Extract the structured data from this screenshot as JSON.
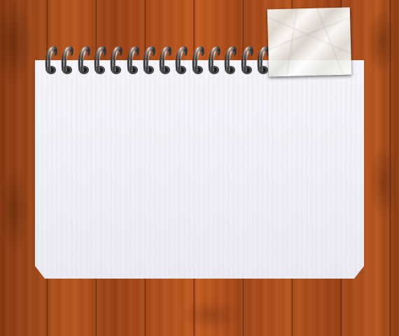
{
  "scene": {
    "background": "wooden-desk",
    "colors": {
      "wood": "#a84c1b",
      "paper": "#f2f2f8",
      "sticky_note": "#f4f4f2",
      "ring_metal": "#6b6b6b"
    }
  },
  "notepad": {
    "ring_count": 14,
    "page_text": ""
  },
  "sticky_note": {
    "text": ""
  }
}
